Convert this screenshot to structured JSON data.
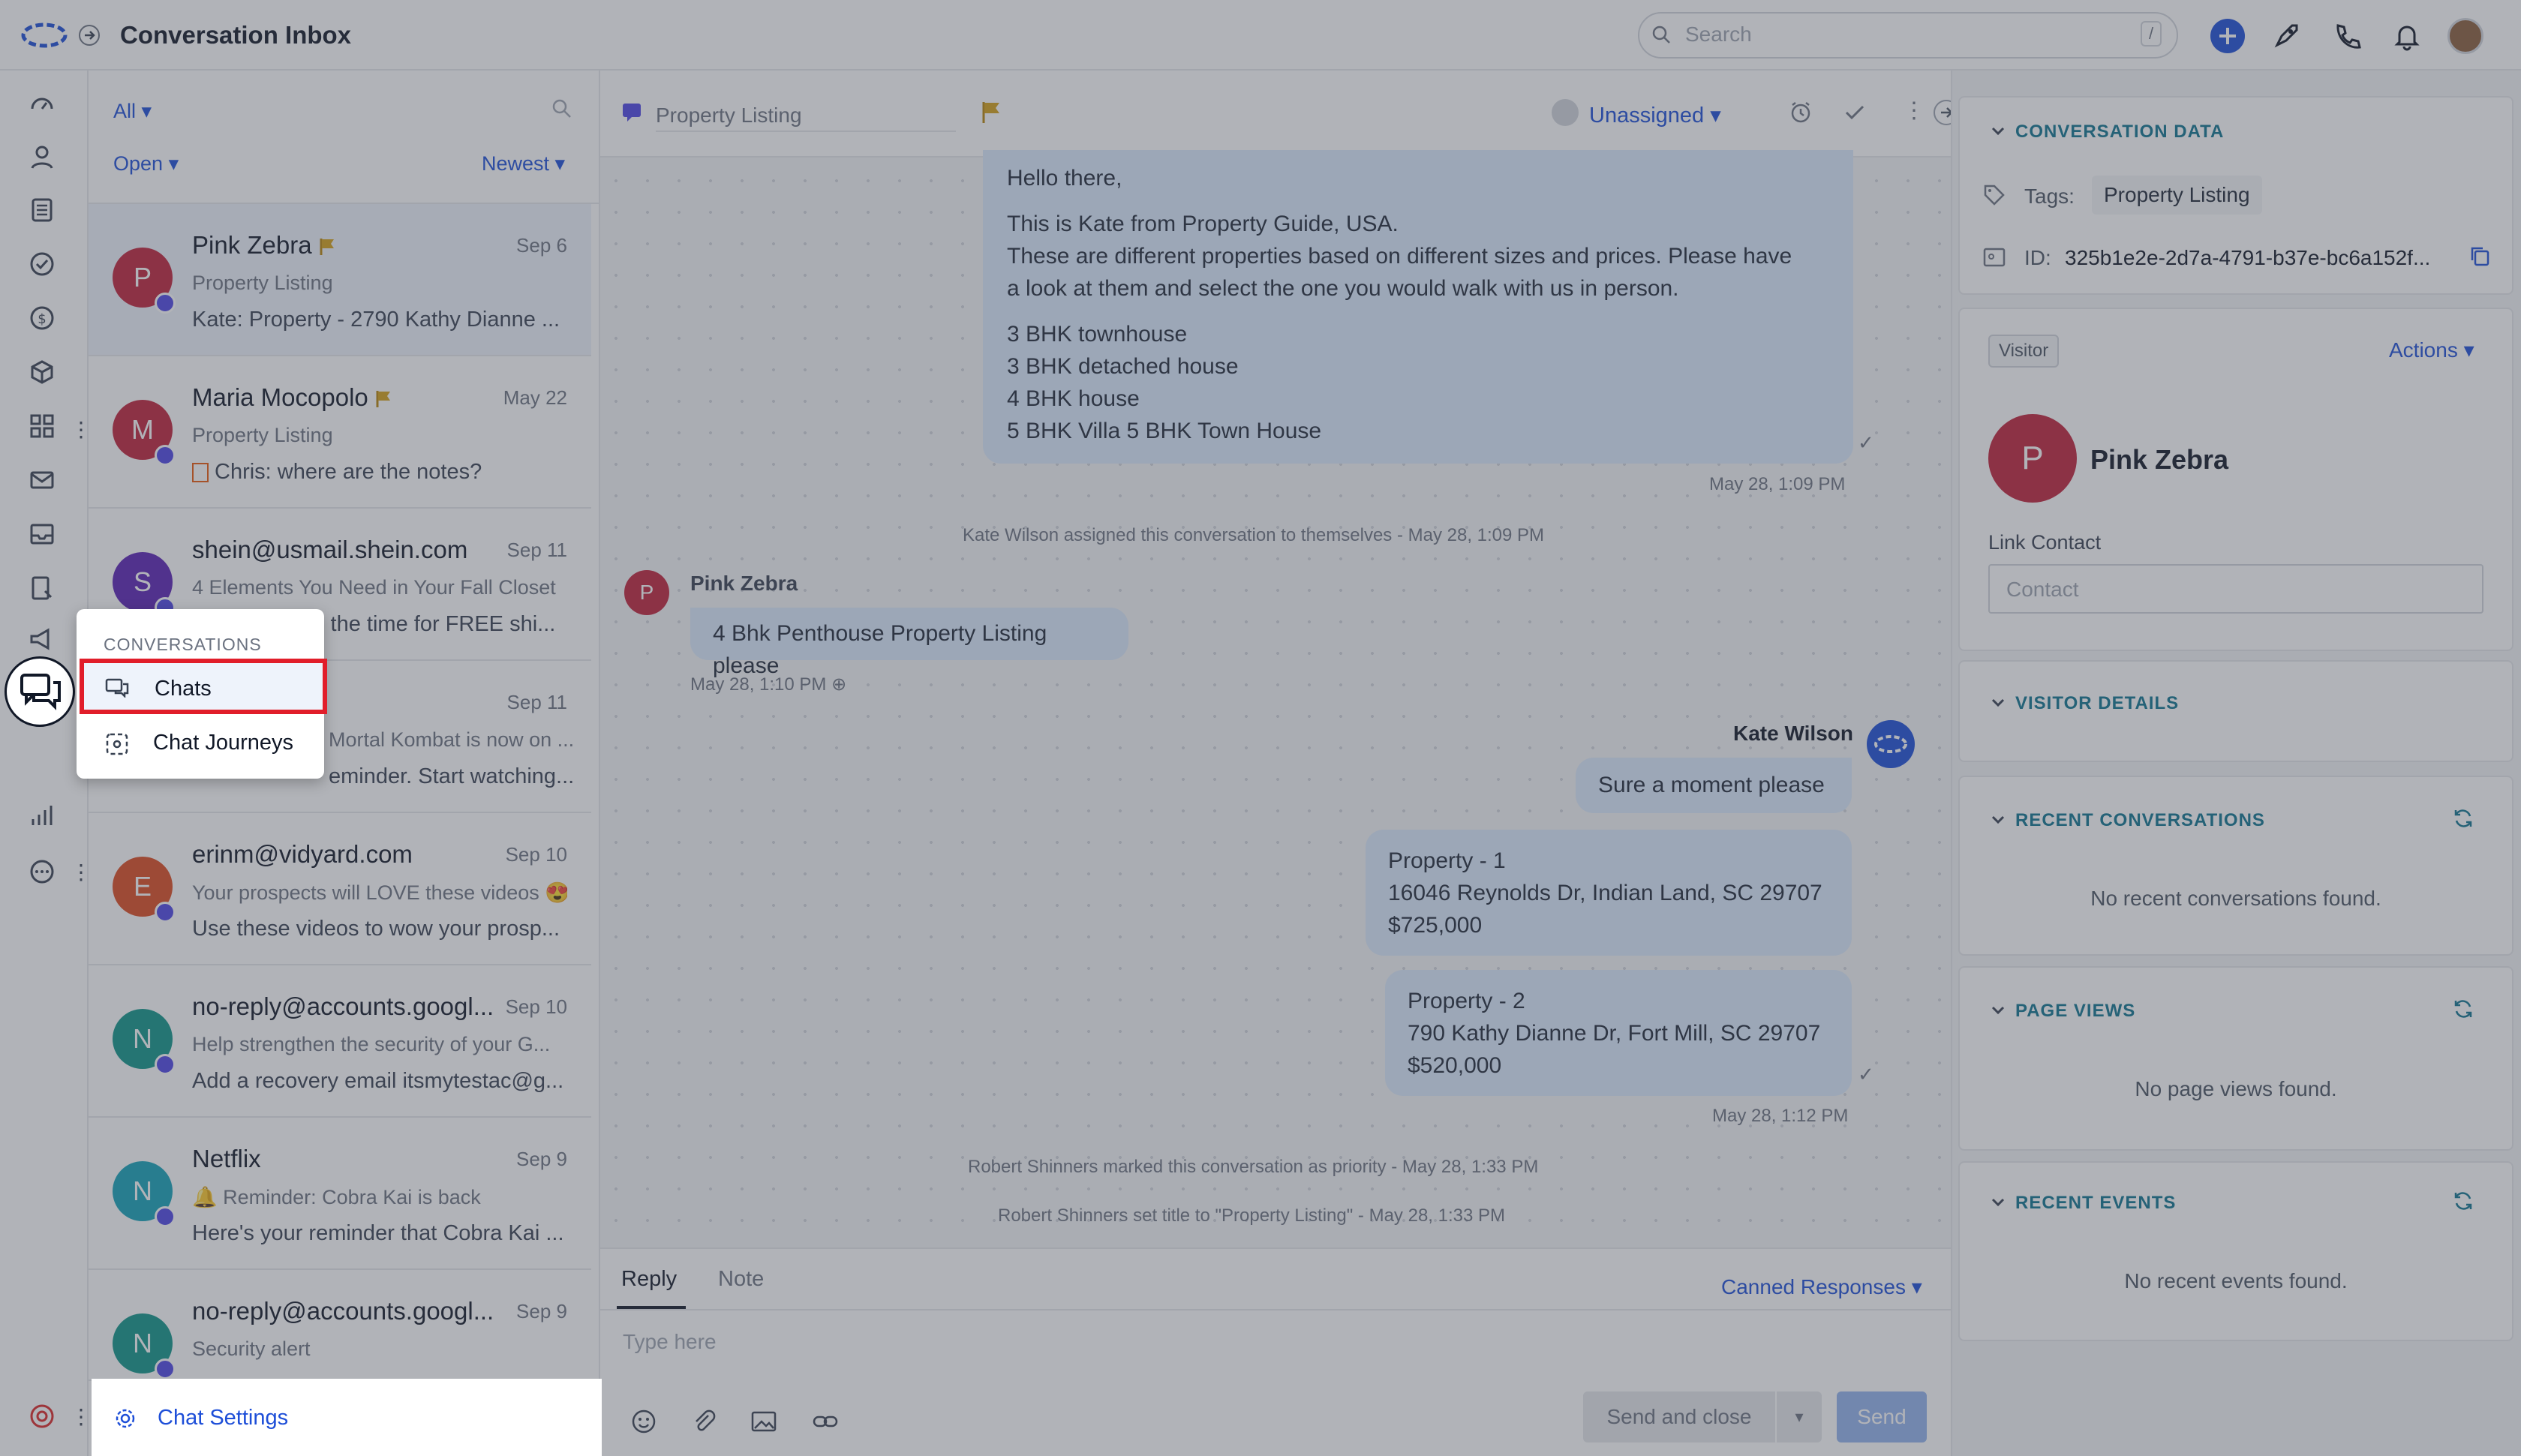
{
  "header": {
    "title": "Conversation Inbox",
    "search_placeholder": "Search",
    "search_shortcut": "/"
  },
  "list": {
    "filter_all": "All",
    "filter_status": "Open",
    "filter_sort": "Newest",
    "items": [
      {
        "name": "Pink Zebra",
        "date": "Sep 6",
        "subject": "Property Listing",
        "snippet": "Kate: Property - 2790 Kathy Dianne ...",
        "initial": "P",
        "color": "#c0213a",
        "flag": true
      },
      {
        "name": "Maria Mocopolo",
        "date": "May 22",
        "subject": "Property Listing",
        "snippet": "Chris: where are the notes?",
        "initial": "M",
        "color": "#c0213a",
        "flag": true
      },
      {
        "name": "shein@usmail.shein.com",
        "date": "Sep 11",
        "subject": "4 Elements You Need in Your Fall Closet",
        "snippet": "s the time for FREE shi...",
        "initial": "S",
        "color": "#5b21b6",
        "flag": false
      },
      {
        "name": "",
        "date": "Sep 11",
        "subject": "Mortal Kombat is now on ...",
        "snippet": "eminder. Start watching...",
        "initial": "",
        "color": "#0d9488",
        "flag": false
      },
      {
        "name": "erinm@vidyard.com",
        "date": "Sep 10",
        "subject": "Your prospects will LOVE these videos 😍",
        "snippet": "Use these videos to wow your prosp...",
        "initial": "E",
        "color": "#dc4a1f",
        "flag": false
      },
      {
        "name": "no-reply@accounts.googl...",
        "date": "Sep 10",
        "subject": "Help strengthen the security of your G...",
        "snippet": "Add a recovery email itsmytestac@g...",
        "initial": "N",
        "color": "#0f9488",
        "flag": false
      },
      {
        "name": "Netflix",
        "date": "Sep 9",
        "subject": "🔔 Reminder: Cobra Kai is back",
        "snippet": "Here's your reminder that Cobra Kai ...",
        "initial": "N",
        "color": "#14a3b8",
        "flag": false
      },
      {
        "name": "no-reply@accounts.googl...",
        "date": "Sep 9",
        "subject": "Security alert",
        "snippet": "",
        "initial": "N",
        "color": "#0f9488",
        "flag": false
      }
    ],
    "chat_settings": "Chat Settings"
  },
  "popup": {
    "section": "CONVERSATIONS",
    "items": [
      "Chats",
      "Chat Journeys"
    ]
  },
  "chat": {
    "title": "Property Listing",
    "assignee": "Unassigned",
    "msg1": {
      "greeting": "Hello there,",
      "p1": "This is Kate from Property Guide, USA.",
      "p2": "These are different properties based on different sizes and prices. Please have",
      "p3": "a look at them and select the one you would walk with us in person.",
      "l1": "3 BHK townhouse",
      "l2": "3 BHK detached house",
      "l3": "4 BHK house",
      "l4": "5 BHK Villa 5 BHK Town House",
      "time": "May 28, 1:09 PM"
    },
    "sys1": "Kate Wilson assigned this conversation to themselves - May 28, 1:09 PM",
    "visitor_name": "Pink Zebra",
    "visitor_initial": "P",
    "visitor_msg": "4 Bhk Penthouse Property Listing please",
    "visitor_time": "May 28, 1:10 PM",
    "agent_name": "Kate Wilson",
    "agent_msg": "Sure a moment please",
    "prop1": {
      "l1": "Property - 1",
      "l2": "16046 Reynolds Dr, Indian Land, SC 29707",
      "l3": "$725,000"
    },
    "prop2": {
      "l1": "Property - 2",
      "l2": "790 Kathy Dianne Dr, Fort Mill, SC 29707",
      "l3": "$520,000"
    },
    "prop_time": "May 28, 1:12 PM",
    "sys2": "Robert Shinners marked this conversation as priority - May 28, 1:33 PM",
    "sys3": "Robert Shinners set title to \"Property Listing\" - May 28, 1:33 PM"
  },
  "composer": {
    "tab_reply": "Reply",
    "tab_note": "Note",
    "canned": "Canned Responses",
    "placeholder": "Type here",
    "send_close": "Send and close",
    "send": "Send"
  },
  "right": {
    "conv_data": "CONVERSATION DATA",
    "tags_label": "Tags:",
    "tag": "Property Listing",
    "id_label": "ID:",
    "id_value": "325b1e2e-2d7a-4791-b37e-bc6a152f...",
    "visitor_badge": "Visitor",
    "actions": "Actions",
    "contact_name": "Pink Zebra",
    "contact_initial": "P",
    "link_contact": "Link Contact",
    "contact_placeholder": "Contact",
    "visitor_details": "VISITOR DETAILS",
    "recent_conversations": "RECENT CONVERSATIONS",
    "recent_conversations_empty": "No recent conversations found.",
    "page_views": "PAGE VIEWS",
    "page_views_empty": "No page views found.",
    "recent_events": "RECENT EVENTS",
    "recent_events_empty": "No recent events found."
  },
  "colors": {
    "brand": "#1d4ed8",
    "accent_teal": "#0e7490",
    "highlight": "#e11d2a",
    "bubble": "#dbeafe"
  }
}
